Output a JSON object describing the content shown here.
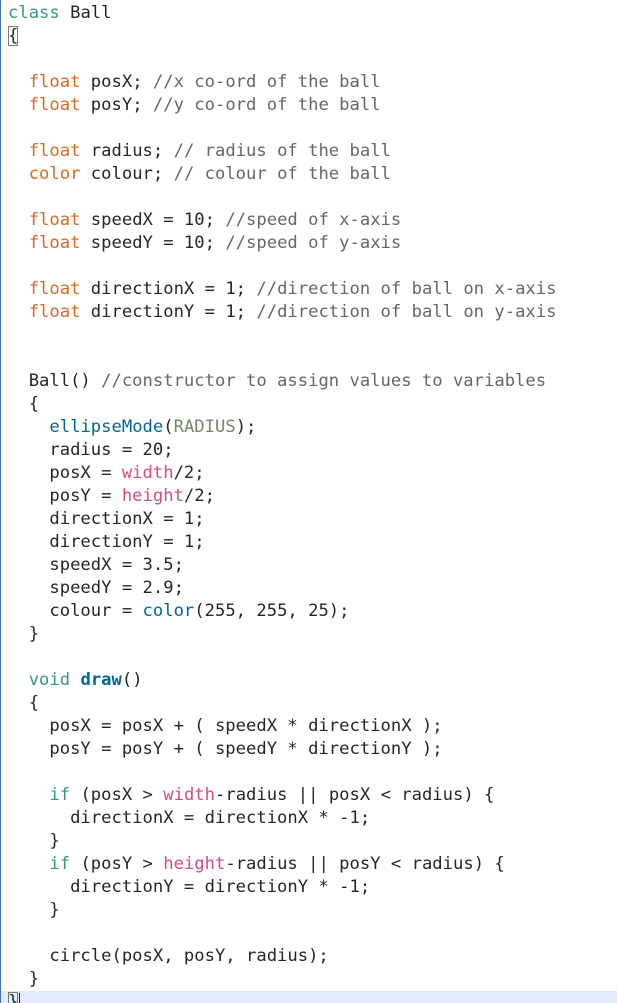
{
  "editor": {
    "language": "Processing",
    "colors": {
      "keyword": "#33997e",
      "type": "#e2661a",
      "function": "#006699",
      "constant": "#718a62",
      "builtin_variable": "#d94a7a",
      "comment": "#666666",
      "text": "#262626",
      "current_line_bg": "#e2ebfa"
    },
    "lines": [
      [
        {
          "t": "class",
          "c": "kw"
        },
        {
          "t": " Ball",
          "c": "plain"
        }
      ],
      [
        {
          "t": "{",
          "c": "plain",
          "box": true
        }
      ],
      [
        {
          "t": "",
          "c": "plain"
        }
      ],
      [
        {
          "t": "  ",
          "c": "plain"
        },
        {
          "t": "float",
          "c": "type"
        },
        {
          "t": " posX; ",
          "c": "plain"
        },
        {
          "t": "//x co-ord of the ball",
          "c": "cm"
        }
      ],
      [
        {
          "t": "  ",
          "c": "plain"
        },
        {
          "t": "float",
          "c": "type"
        },
        {
          "t": " posY; ",
          "c": "plain"
        },
        {
          "t": "//y co-ord of the ball",
          "c": "cm"
        }
      ],
      [
        {
          "t": "",
          "c": "plain"
        }
      ],
      [
        {
          "t": "  ",
          "c": "plain"
        },
        {
          "t": "float",
          "c": "type"
        },
        {
          "t": " radius; ",
          "c": "plain"
        },
        {
          "t": "// radius of the ball",
          "c": "cm"
        }
      ],
      [
        {
          "t": "  ",
          "c": "plain"
        },
        {
          "t": "color",
          "c": "type"
        },
        {
          "t": " colour; ",
          "c": "plain"
        },
        {
          "t": "// colour of the ball",
          "c": "cm"
        }
      ],
      [
        {
          "t": "",
          "c": "plain"
        }
      ],
      [
        {
          "t": "  ",
          "c": "plain"
        },
        {
          "t": "float",
          "c": "type"
        },
        {
          "t": " speedX = 10; ",
          "c": "plain"
        },
        {
          "t": "//speed of x-axis",
          "c": "cm"
        }
      ],
      [
        {
          "t": "  ",
          "c": "plain"
        },
        {
          "t": "float",
          "c": "type"
        },
        {
          "t": " speedY = 10; ",
          "c": "plain"
        },
        {
          "t": "//speed of y-axis",
          "c": "cm"
        }
      ],
      [
        {
          "t": "",
          "c": "plain"
        }
      ],
      [
        {
          "t": "  ",
          "c": "plain"
        },
        {
          "t": "float",
          "c": "type"
        },
        {
          "t": " directionX = 1; ",
          "c": "plain"
        },
        {
          "t": "//direction of ball on x-axis",
          "c": "cm"
        }
      ],
      [
        {
          "t": "  ",
          "c": "plain"
        },
        {
          "t": "float",
          "c": "type"
        },
        {
          "t": " directionY = 1; ",
          "c": "plain"
        },
        {
          "t": "//direction of ball on y-axis",
          "c": "cm"
        }
      ],
      [
        {
          "t": "",
          "c": "plain"
        }
      ],
      [
        {
          "t": "",
          "c": "plain"
        }
      ],
      [
        {
          "t": "  Ball() ",
          "c": "plain"
        },
        {
          "t": "//constructor to assign values to variables",
          "c": "cm"
        }
      ],
      [
        {
          "t": "  {",
          "c": "plain"
        }
      ],
      [
        {
          "t": "    ",
          "c": "plain"
        },
        {
          "t": "ellipseMode",
          "c": "fn"
        },
        {
          "t": "(",
          "c": "plain"
        },
        {
          "t": "RADIUS",
          "c": "const"
        },
        {
          "t": ");",
          "c": "plain"
        }
      ],
      [
        {
          "t": "    radius = 20;",
          "c": "plain"
        }
      ],
      [
        {
          "t": "    posX = ",
          "c": "plain"
        },
        {
          "t": "width",
          "c": "var"
        },
        {
          "t": "/2;",
          "c": "plain"
        }
      ],
      [
        {
          "t": "    posY = ",
          "c": "plain"
        },
        {
          "t": "height",
          "c": "var"
        },
        {
          "t": "/2;",
          "c": "plain"
        }
      ],
      [
        {
          "t": "    directionX = 1;",
          "c": "plain"
        }
      ],
      [
        {
          "t": "    directionY = 1;",
          "c": "plain"
        }
      ],
      [
        {
          "t": "    speedX = 3.5;",
          "c": "plain"
        }
      ],
      [
        {
          "t": "    speedY = 2.9;",
          "c": "plain"
        }
      ],
      [
        {
          "t": "    colour = ",
          "c": "plain"
        },
        {
          "t": "color",
          "c": "fn"
        },
        {
          "t": "(255, 255, 25);",
          "c": "plain"
        }
      ],
      [
        {
          "t": "  }",
          "c": "plain"
        }
      ],
      [
        {
          "t": "",
          "c": "plain"
        }
      ],
      [
        {
          "t": "  ",
          "c": "plain"
        },
        {
          "t": "void",
          "c": "kw"
        },
        {
          "t": " ",
          "c": "plain"
        },
        {
          "t": "draw",
          "c": "fn-bold"
        },
        {
          "t": "()",
          "c": "plain"
        }
      ],
      [
        {
          "t": "  {",
          "c": "plain"
        }
      ],
      [
        {
          "t": "    posX = posX + ( speedX * directionX );",
          "c": "plain"
        }
      ],
      [
        {
          "t": "    posY = posY + ( speedY * directionY );",
          "c": "plain"
        }
      ],
      [
        {
          "t": "",
          "c": "plain"
        }
      ],
      [
        {
          "t": "    ",
          "c": "plain"
        },
        {
          "t": "if",
          "c": "kw"
        },
        {
          "t": " (posX > ",
          "c": "plain"
        },
        {
          "t": "width",
          "c": "var"
        },
        {
          "t": "-radius || posX < radius) {",
          "c": "plain"
        }
      ],
      [
        {
          "t": "      directionX = directionX * -1;",
          "c": "plain"
        }
      ],
      [
        {
          "t": "    }",
          "c": "plain"
        }
      ],
      [
        {
          "t": "    ",
          "c": "plain"
        },
        {
          "t": "if",
          "c": "kw"
        },
        {
          "t": " (posY > ",
          "c": "plain"
        },
        {
          "t": "height",
          "c": "var"
        },
        {
          "t": "-radius || posY < radius) {",
          "c": "plain"
        }
      ],
      [
        {
          "t": "      directionY = directionY * -1;",
          "c": "plain"
        }
      ],
      [
        {
          "t": "    }",
          "c": "plain"
        }
      ],
      [
        {
          "t": "",
          "c": "plain"
        }
      ],
      [
        {
          "t": "    circle(posX, posY, radius);",
          "c": "plain"
        }
      ],
      [
        {
          "t": "  }",
          "c": "plain"
        }
      ],
      [
        {
          "t": "}",
          "c": "plain",
          "box": true,
          "caret": true,
          "current": true
        }
      ]
    ]
  }
}
